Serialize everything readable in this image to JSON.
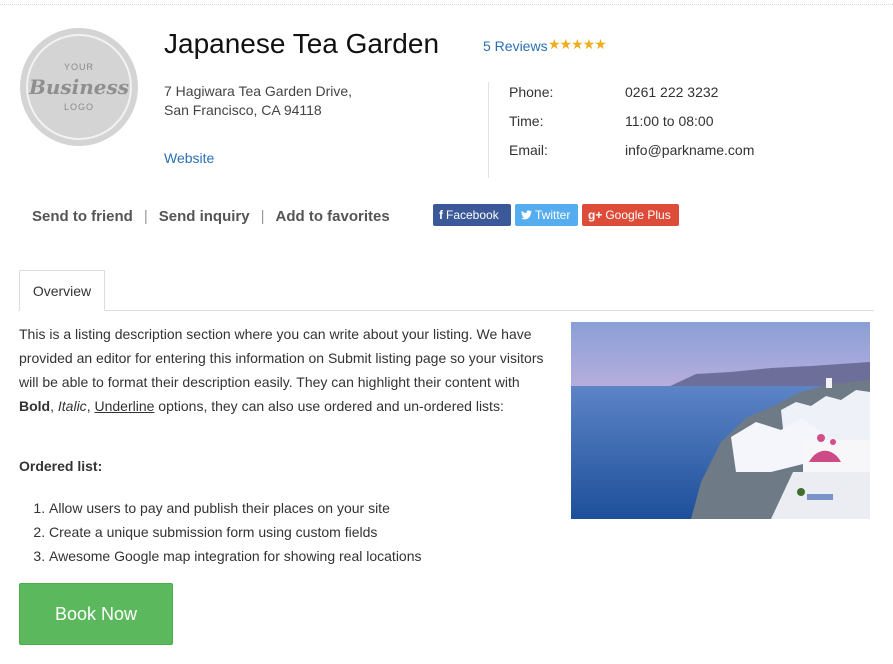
{
  "logo": {
    "line1": "YOUR",
    "line2": "Business",
    "line3": "LOGO"
  },
  "listing": {
    "title": "Japanese Tea Garden",
    "reviews_label": "5 Reviews",
    "rating": 5,
    "rating_max": 5,
    "stars": "★★★★★",
    "address": "7 Hagiwara Tea Garden Drive, San Francisco, CA 94118",
    "website_label": "Website"
  },
  "contact": [
    {
      "label": "Phone:",
      "value": "0261 222 3232"
    },
    {
      "label": "Time:",
      "value": "11:00 to 08:00"
    },
    {
      "label": "Email:",
      "value": "info@parkname.com"
    }
  ],
  "actions": {
    "send_to_friend": "Send to friend",
    "send_inquiry": "Send inquiry",
    "add_to_favorites": "Add to favorites",
    "separator": "|"
  },
  "social": {
    "facebook": {
      "icon": "f",
      "label": "Facebook",
      "color": "#3b5998"
    },
    "twitter": {
      "icon": "🐦",
      "label": "Twitter",
      "color": "#55acee"
    },
    "googleplus": {
      "icon": "g+",
      "label": "Google Plus",
      "color": "#dd4b39"
    }
  },
  "tabs": [
    {
      "label": "Overview",
      "active": true
    }
  ],
  "overview": {
    "desc_part1": "This is a listing description section where you can write about your listing. We have provided an editor for entering this information on Submit listing page so your visitors will be able to format their description easily. They can highlight their content with ",
    "bold_word": "Bold",
    "comma1": ", ",
    "italic_word": "Italic",
    "comma2": ", ",
    "underline_word": "Underline",
    "desc_part2": " options, they can also use ordered and un-ordered lists:",
    "ordered_heading": "Ordered list:",
    "ordered_items": [
      "Allow users to pay and publish their places on your site",
      "Create a unique submission form using custom fields",
      "Awesome Google map integration for showing real locations"
    ]
  },
  "book_button": "Book Now",
  "colors": {
    "link": "#2a6fb5",
    "star": "#f0ad1e",
    "book": "#5cb85c"
  }
}
